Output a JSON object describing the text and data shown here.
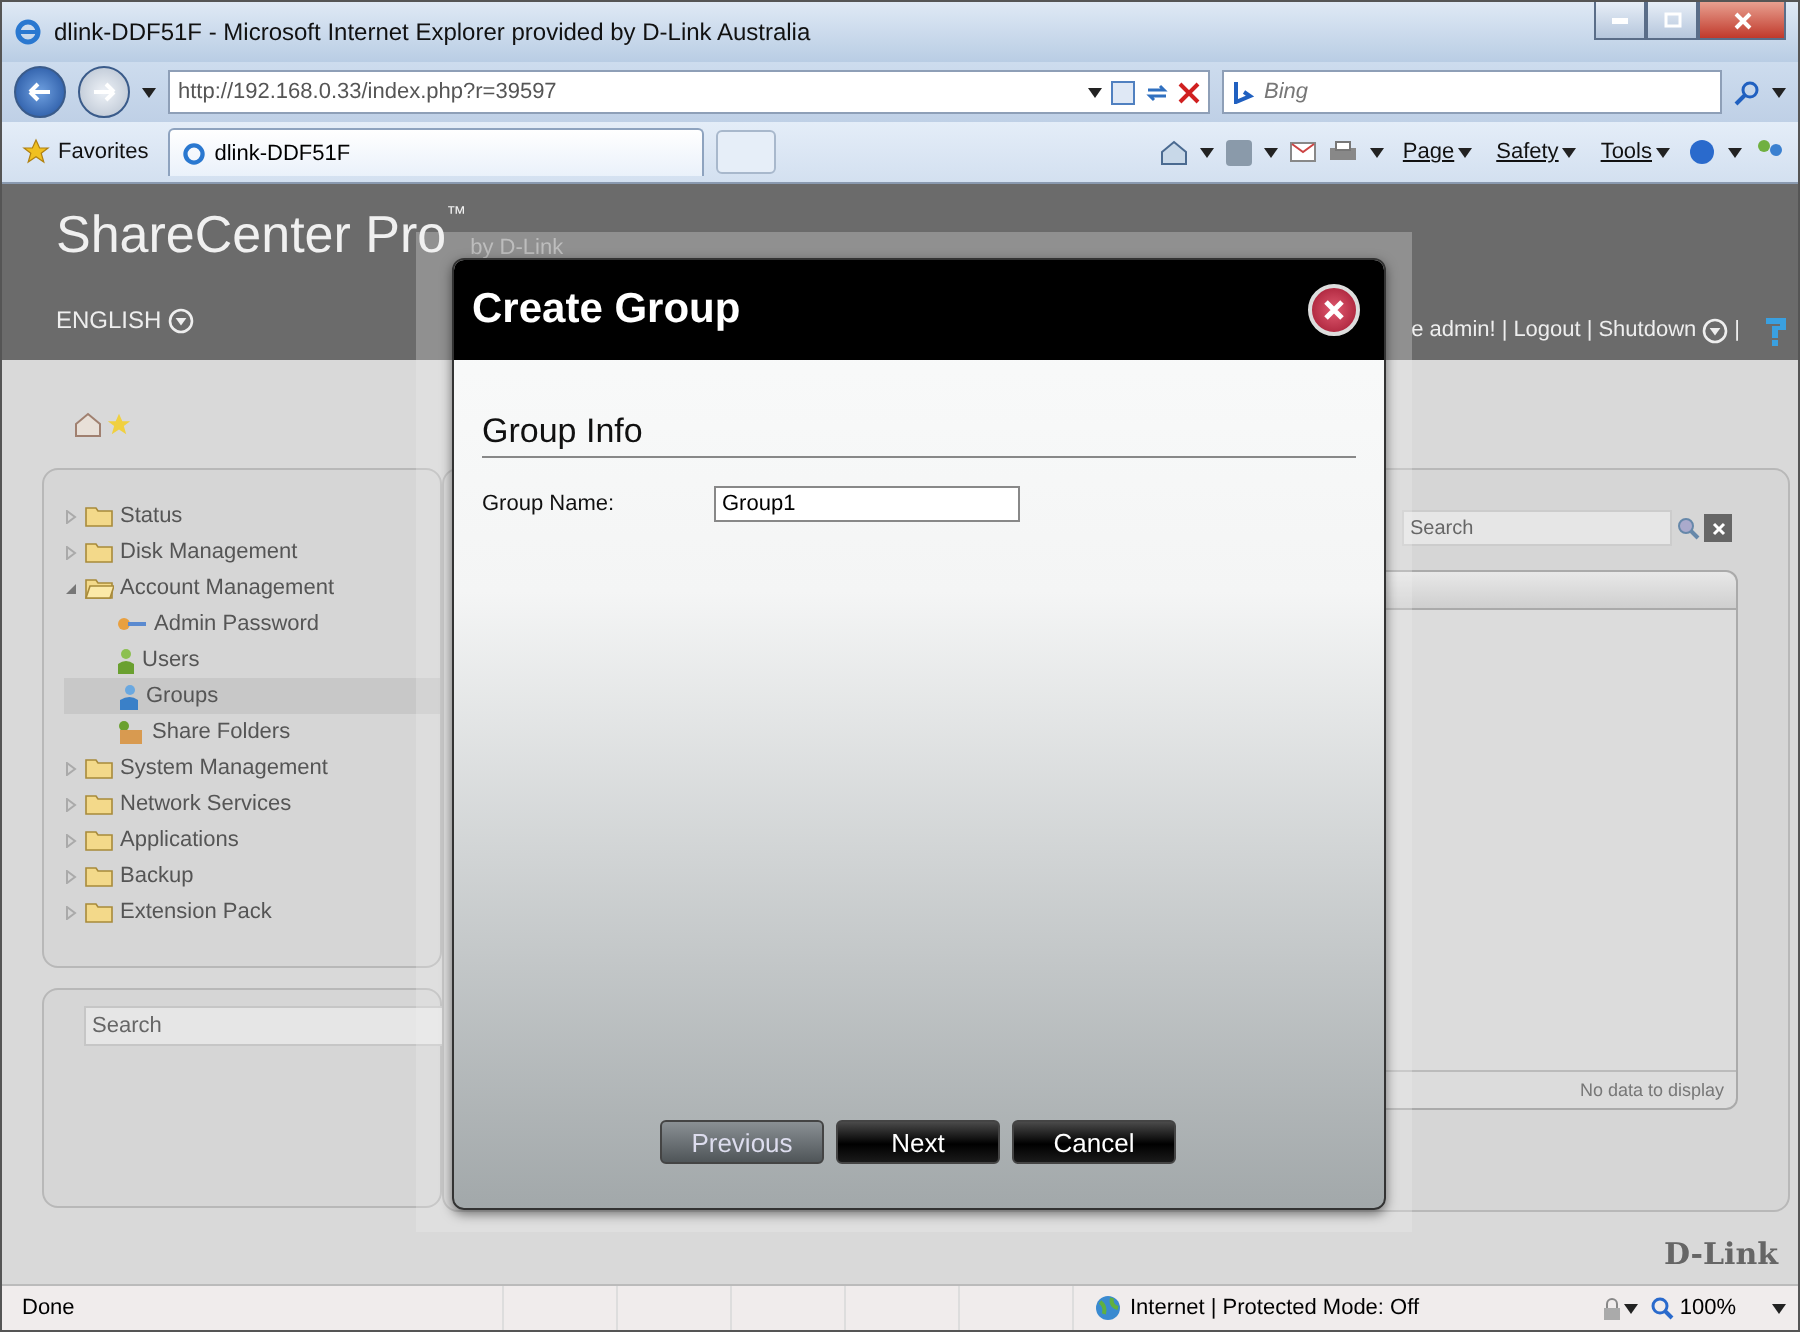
{
  "window": {
    "title": "dlink-DDF51F - Microsoft Internet Explorer provided by D-Link Australia"
  },
  "address_bar": {
    "url": "http://192.168.0.33/index.php?r=39597",
    "search_placeholder": "Bing"
  },
  "favorites_bar": {
    "favorites": "Favorites",
    "tab": "dlink-DDF51F",
    "menus": [
      "Page",
      "Safety",
      "Tools"
    ]
  },
  "app": {
    "brand": "ShareCenter Pro",
    "trademark": "™",
    "byline": "by D-Link",
    "language": "ENGLISH",
    "user_links": [
      "e admin!",
      "Logout",
      "Shutdown"
    ],
    "separator": "|",
    "tree": [
      {
        "label": "Status",
        "expanded": false,
        "selected": false
      },
      {
        "label": "Disk Management",
        "expanded": false,
        "selected": false
      },
      {
        "label": "Account Management",
        "expanded": true,
        "selected": false,
        "children": [
          {
            "label": "Admin Password",
            "kind": "key",
            "selected": false
          },
          {
            "label": "Users",
            "kind": "user",
            "selected": false
          },
          {
            "label": "Groups",
            "kind": "group",
            "selected": true
          },
          {
            "label": "Share Folders",
            "kind": "share",
            "selected": false
          }
        ]
      },
      {
        "label": "System Management",
        "expanded": false,
        "selected": false
      },
      {
        "label": "Network Services",
        "expanded": false,
        "selected": false
      },
      {
        "label": "Applications",
        "expanded": false,
        "selected": false
      },
      {
        "label": "Backup",
        "expanded": false,
        "selected": false
      },
      {
        "label": "Extension Pack",
        "expanded": false,
        "selected": false
      }
    ],
    "left_search": {
      "placeholder": "Search"
    },
    "right_search": {
      "placeholder": "Search"
    },
    "table_footer": "No data to display",
    "logo": "D-Link"
  },
  "dialog": {
    "title": "Create Group",
    "section": "Group Info",
    "field_label": "Group Name:",
    "field_value": "Group1",
    "buttons": [
      {
        "label": "Previous",
        "disabled": true
      },
      {
        "label": "Next",
        "disabled": false
      },
      {
        "label": "Cancel",
        "disabled": false
      }
    ]
  },
  "status_bar": {
    "status": "Done",
    "zone": "Internet | Protected Mode: Off",
    "zoom": "100%"
  }
}
